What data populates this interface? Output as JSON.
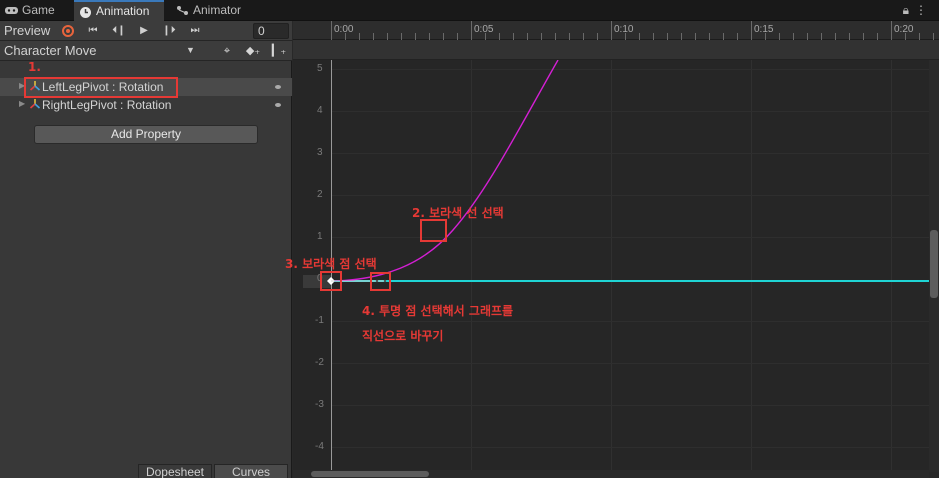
{
  "tabs": [
    {
      "label": "Game",
      "icon": "gamepad-icon"
    },
    {
      "label": "Animation",
      "icon": "clock-icon"
    },
    {
      "label": "Animator",
      "icon": "animator-icon"
    }
  ],
  "toolbar": {
    "preview_label": "Preview",
    "frame_value": "0",
    "buttons": [
      "record-button",
      "first-key-button",
      "prev-key-button",
      "play-button",
      "next-key-button"
    ]
  },
  "clip": {
    "name": "Character Move",
    "tools": [
      "add-event-icon",
      "add-keyframe-icon",
      "add-event-marker-icon"
    ]
  },
  "properties": [
    {
      "label": "LeftLegPivot : Rotation",
      "selected": true
    },
    {
      "label": "RightLegPivot : Rotation",
      "selected": false
    }
  ],
  "add_property_label": "Add Property",
  "view_tabs": [
    "Dopesheet",
    "Curves"
  ],
  "ruler": {
    "labels": [
      "0:00",
      "0:05",
      "0:10",
      "0:15",
      "0:20"
    ]
  },
  "graph": {
    "y_labels": [
      "5",
      "4",
      "3",
      "2",
      "1",
      "0",
      "-1",
      "-2",
      "-3",
      "-4"
    ],
    "curve_colors": {
      "magenta": "#d41fd4",
      "cyan": "#1fd4d4"
    }
  },
  "annotations": {
    "step1": "1.",
    "step2": "2. 보라색 선 선택",
    "step3": "3. 보라색 점 선택",
    "step4_line1": "4. 투명 점 선택해서 그래프를",
    "step4_line2": "직선으로 바꾸기"
  },
  "window_buttons": [
    "lock-icon",
    "menu-icon"
  ]
}
